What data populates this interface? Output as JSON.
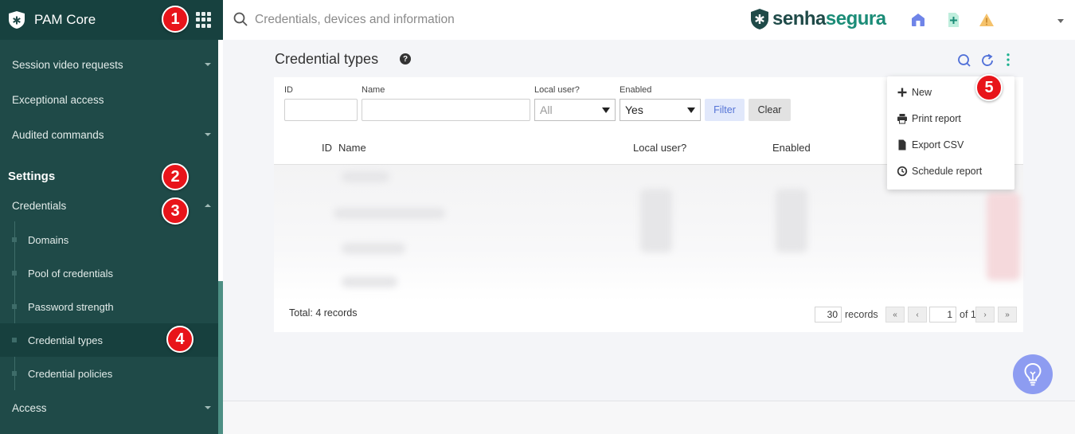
{
  "sidebar": {
    "title": "PAM Core",
    "items": [
      {
        "label": "Session video requests"
      },
      {
        "label": "Exceptional access"
      },
      {
        "label": "Audited commands"
      }
    ],
    "section": "Settings",
    "credentials_label": "Credentials",
    "sub_items": [
      {
        "label": "Domains"
      },
      {
        "label": "Pool of credentials"
      },
      {
        "label": "Password strength"
      },
      {
        "label": "Credential types"
      },
      {
        "label": "Credential policies"
      }
    ],
    "access_label": "Access"
  },
  "topbar": {
    "search_placeholder": "Credentials, devices and information",
    "brand_part1": "senha",
    "brand_part2": "segura"
  },
  "page": {
    "title": "Credential types"
  },
  "filters": {
    "id_label": "ID",
    "name_label": "Name",
    "local_user_label": "Local user?",
    "local_user_value": "All",
    "enabled_label": "Enabled",
    "enabled_value": "Yes",
    "filter_button": "Filter",
    "clear_button": "Clear"
  },
  "table": {
    "columns": [
      "ID",
      "Name",
      "Local user?",
      "Enabled"
    ]
  },
  "footer": {
    "total": "Total: 4 records",
    "per_page": "30",
    "records_label": "records",
    "page_current": "1",
    "page_of": "of 1",
    "first": "«",
    "prev": "‹",
    "next": "›",
    "last": "»"
  },
  "dropdown": {
    "items": [
      {
        "label": "New"
      },
      {
        "label": "Print report"
      },
      {
        "label": "Export CSV"
      },
      {
        "label": "Schedule report"
      }
    ]
  },
  "badges": [
    "1",
    "2",
    "3",
    "4",
    "5"
  ],
  "colors": {
    "sidebar_bg": "#1f4a48",
    "brand_dark": "#1f4a48",
    "brand_green": "#1b8c77",
    "accent_blue": "#5574d6",
    "badge_red": "#e8141a"
  }
}
